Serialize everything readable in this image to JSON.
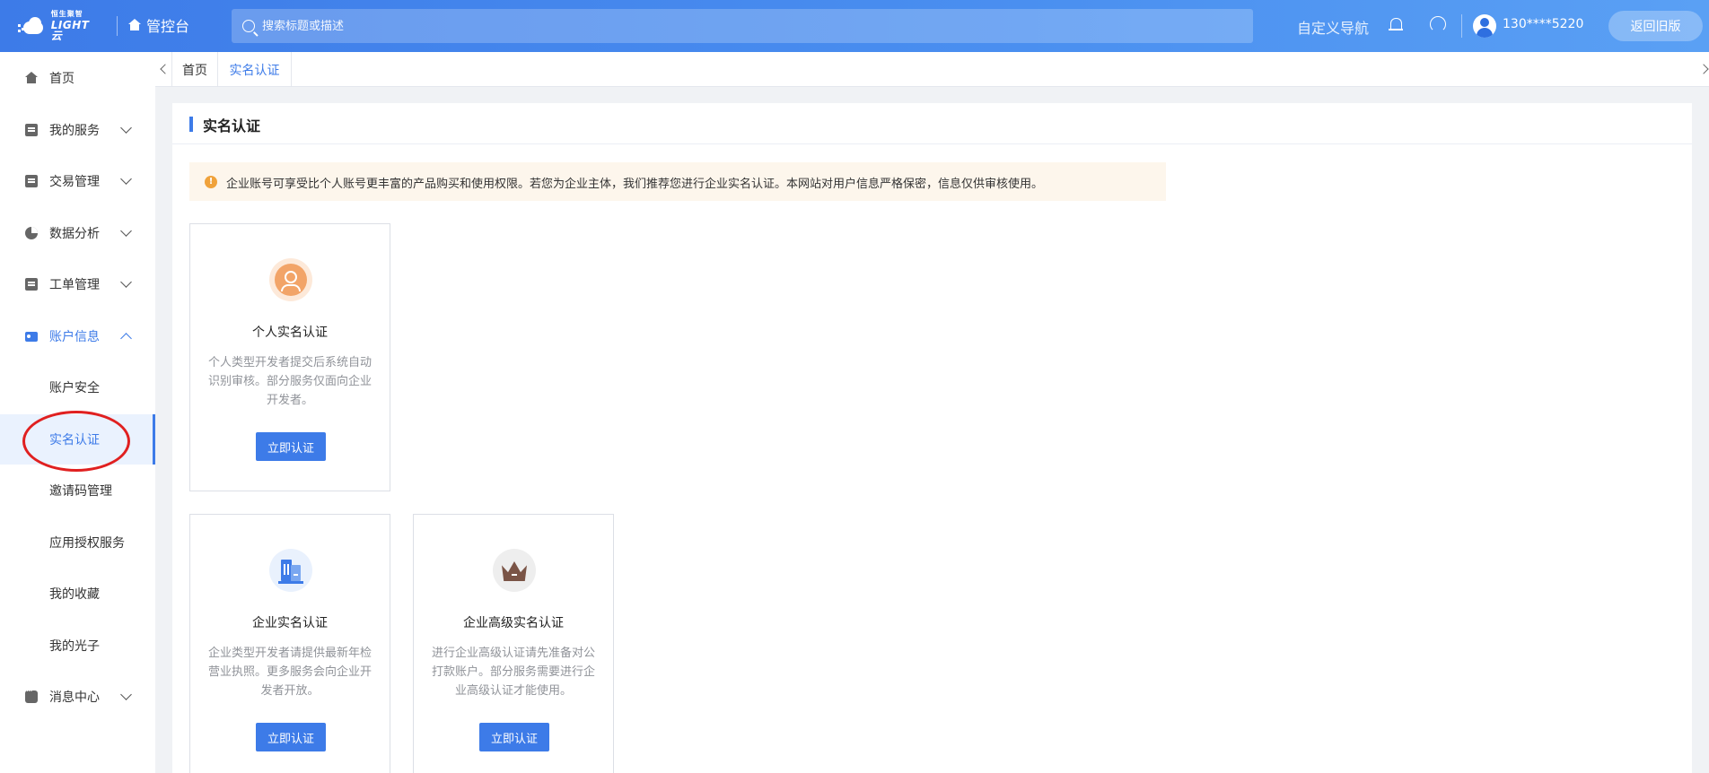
{
  "header": {
    "logo_small": "恒生聚智",
    "logo_big": "LIGHT云",
    "console_label": "管控台",
    "search_placeholder": "搜索标题或描述",
    "custom_nav": "自定义导航",
    "phone": "130****5220",
    "back_button": "返回旧版"
  },
  "sidebar": {
    "home": "首页",
    "my_services": "我的服务",
    "trade": "交易管理",
    "analytics": "数据分析",
    "tickets": "工单管理",
    "account": "账户信息",
    "sub": {
      "security": "账户安全",
      "realname": "实名认证",
      "invite": "邀请码管理",
      "auth_service": "应用授权服务",
      "favorites": "我的收藏",
      "photons": "我的光子"
    },
    "messages": "消息中心"
  },
  "tabs": {
    "home": "首页",
    "realname": "实名认证"
  },
  "page": {
    "title": "实名认证",
    "notice": "企业账号可享受比个人账号更丰富的产品购买和使用权限。若您为企业主体，我们推荐您进行企业实名认证。本网站对用户信息严格保密，信息仅供审核使用。",
    "warn_glyph": "!"
  },
  "cards": {
    "personal": {
      "title": "个人实名认证",
      "desc": "个人类型开发者提交后系统自动识别审核。部分服务仅面向企业开发者。",
      "button": "立即认证"
    },
    "enterprise": {
      "title": "企业实名认证",
      "desc": "企业类型开发者请提供最新年检营业执照。更多服务会向企业开发者开放。",
      "button": "立即认证"
    },
    "enterprise_advanced": {
      "title": "企业高级实名认证",
      "desc": "进行企业高级认证请先准备对公打款账户。部分服务需要进行企业高级认证才能使用。",
      "button": "立即认证"
    }
  },
  "colors": {
    "accent": "#3d7be8",
    "notice_bg": "#fdf6ec",
    "warn": "#f0a23b",
    "annotation": "#e02020"
  }
}
